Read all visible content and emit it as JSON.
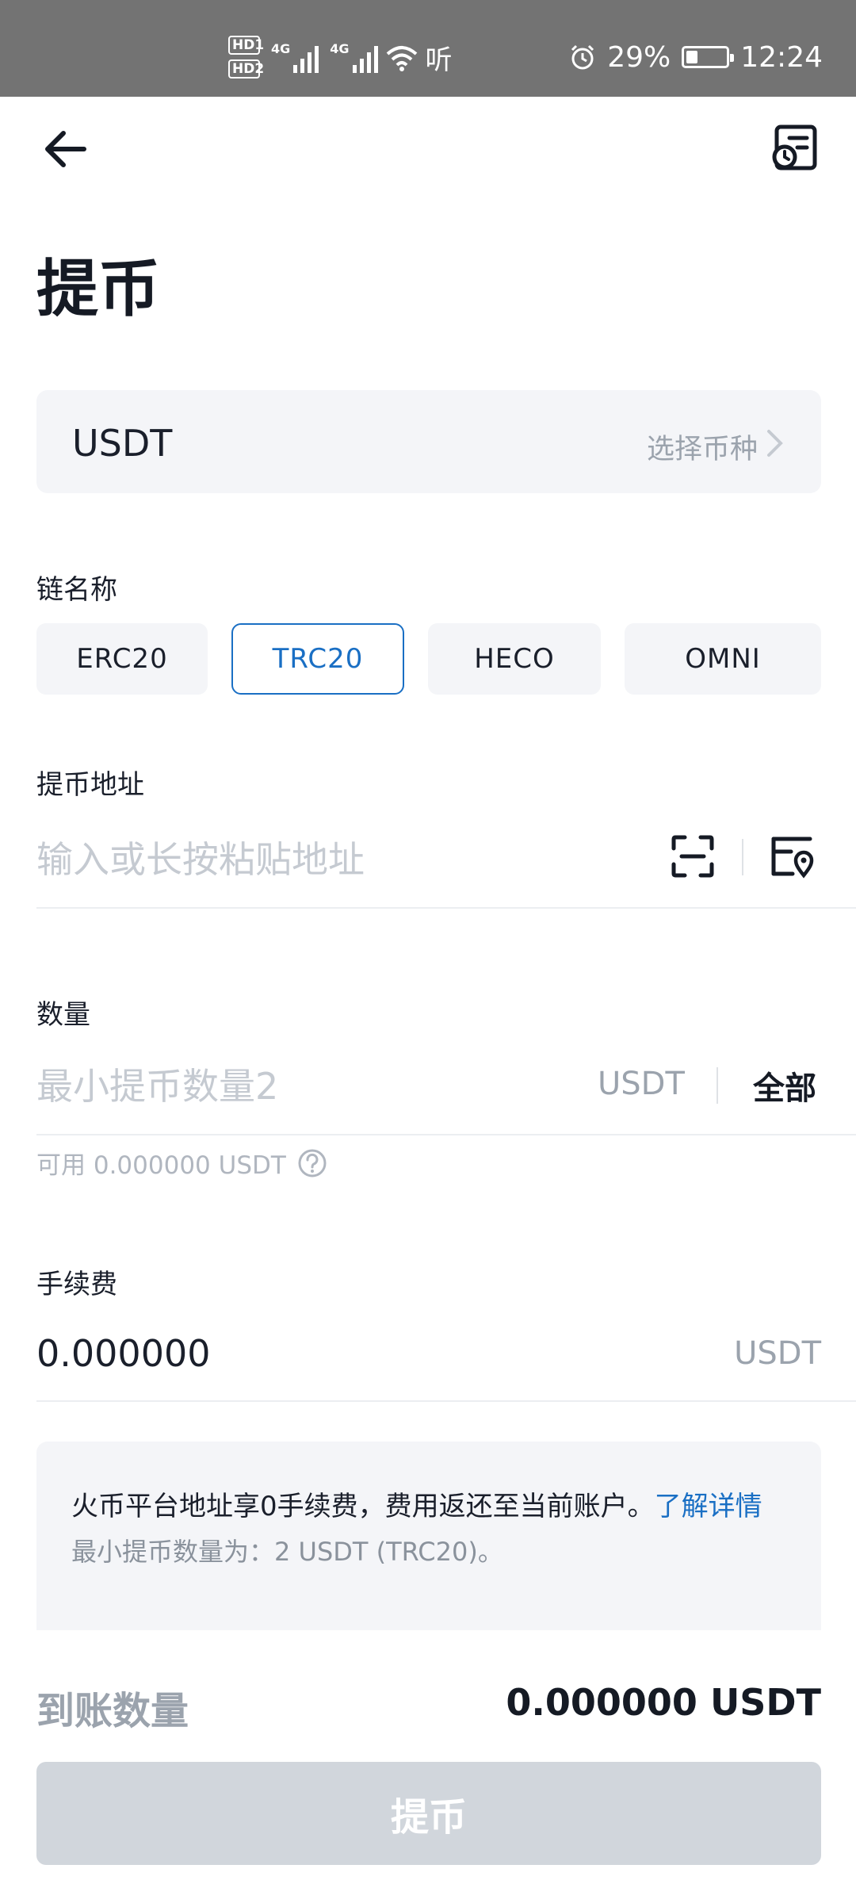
{
  "status_bar": {
    "hd1": "HD1",
    "hd2": "HD2",
    "net1": "4G",
    "net2": "4G",
    "tinglabel": "听",
    "battery": "29%",
    "time": "12:24"
  },
  "header": {
    "title": "提币"
  },
  "coin": {
    "name": "USDT",
    "select_hint": "选择币种"
  },
  "chain": {
    "label": "链名称",
    "options": [
      "ERC20",
      "TRC20",
      "HECO",
      "OMNI"
    ],
    "selected": "TRC20"
  },
  "address": {
    "label": "提币地址",
    "placeholder": "输入或长按粘贴地址",
    "value": ""
  },
  "amount": {
    "label": "数量",
    "placeholder": "最小提币数量2",
    "unit": "USDT",
    "all_label": "全部",
    "available_text": "可用 0.000000 USDT"
  },
  "fee": {
    "label": "手续费",
    "value": "0.000000",
    "unit": "USDT"
  },
  "notice": {
    "main_text": "火币平台地址享0手续费，费用返还至当前账户。",
    "link_text": "了解详情",
    "min_text": "最小提币数量为：2 USDT (TRC20)。"
  },
  "receive": {
    "label": "到账数量",
    "value": "0.000000 USDT"
  },
  "submit": {
    "label": "提币"
  },
  "colors": {
    "accent": "#1a6fc4",
    "status_bar_bg": "#737373",
    "card_bg": "#f4f5f8",
    "disabled_button": "#d1d6dc"
  }
}
